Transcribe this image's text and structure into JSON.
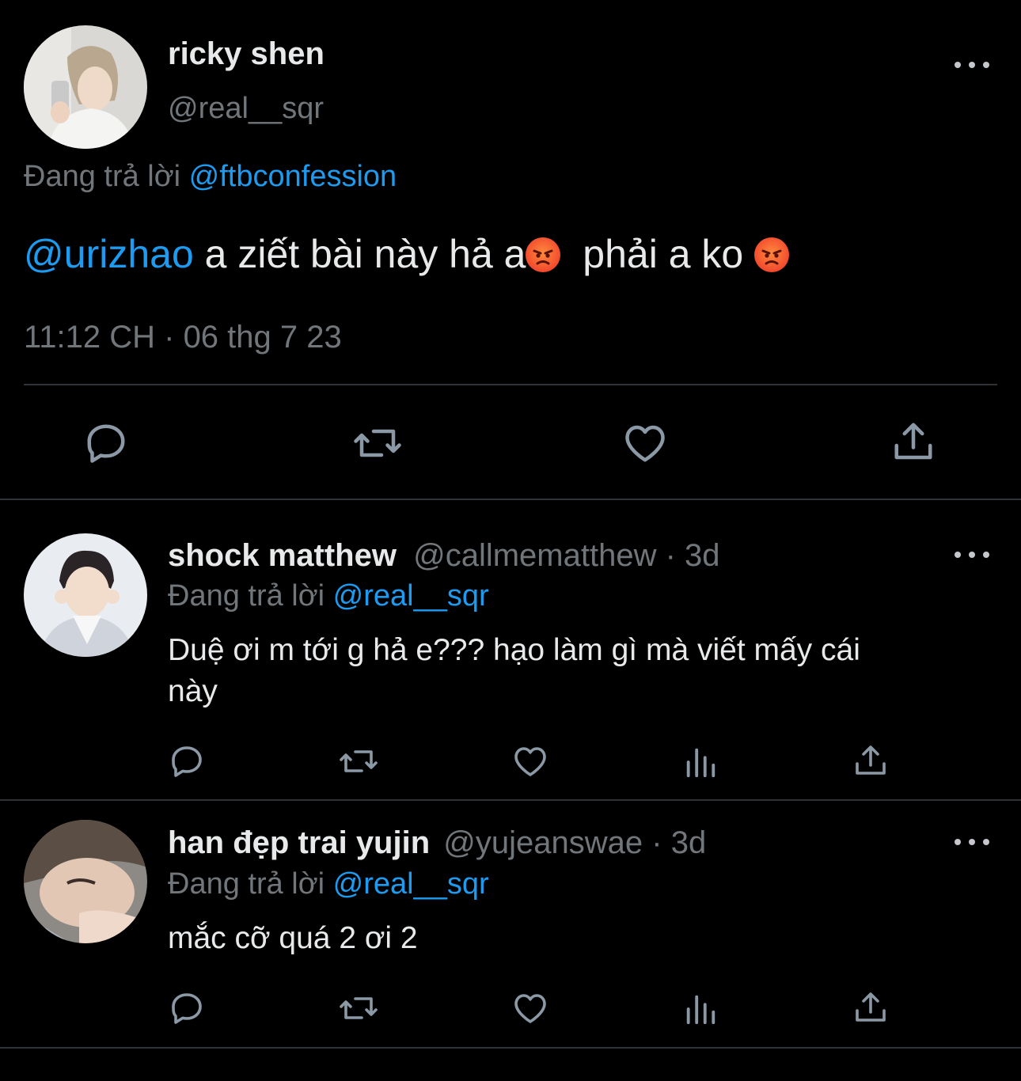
{
  "main_tweet": {
    "display_name": "ricky shen",
    "handle": "@real__sqr",
    "replying_prefix": "Đang trả lời",
    "replying_to": "@ftbconfession",
    "mention": "@urizhao",
    "text_part1": " a ziết bài này hả a",
    "text_part2": "  phải a ko ",
    "emoji": "angry-face",
    "timestamp": "11:12 CH · 06 thg 7 23"
  },
  "replies": [
    {
      "display_name": "shock matthew",
      "handle": "@callmematthew",
      "time": "· 3d",
      "replying_prefix": "Đang trả lời",
      "replying_to": "@real__sqr",
      "line1": "Duệ ơi m tới g hả e??? hạo làm gì mà viết mấy cái",
      "line2": "này"
    },
    {
      "display_name": "han đẹp trai yujin",
      "handle": "@yujeanswae",
      "time": "· 3d",
      "replying_prefix": "Đang trả lời",
      "replying_to": "@real__sqr",
      "line1": "mắc cỡ quá 2 ơi 2"
    }
  ],
  "icons": [
    "reply-icon",
    "retweet-icon",
    "like-icon",
    "share-icon",
    "views-icon",
    "more-icon"
  ],
  "colors": {
    "background": "#000000",
    "text": "#e7e9ea",
    "muted": "#71767b",
    "link": "#1d9bf0",
    "divider": "#2f3336",
    "icon": "#8b98a5"
  }
}
